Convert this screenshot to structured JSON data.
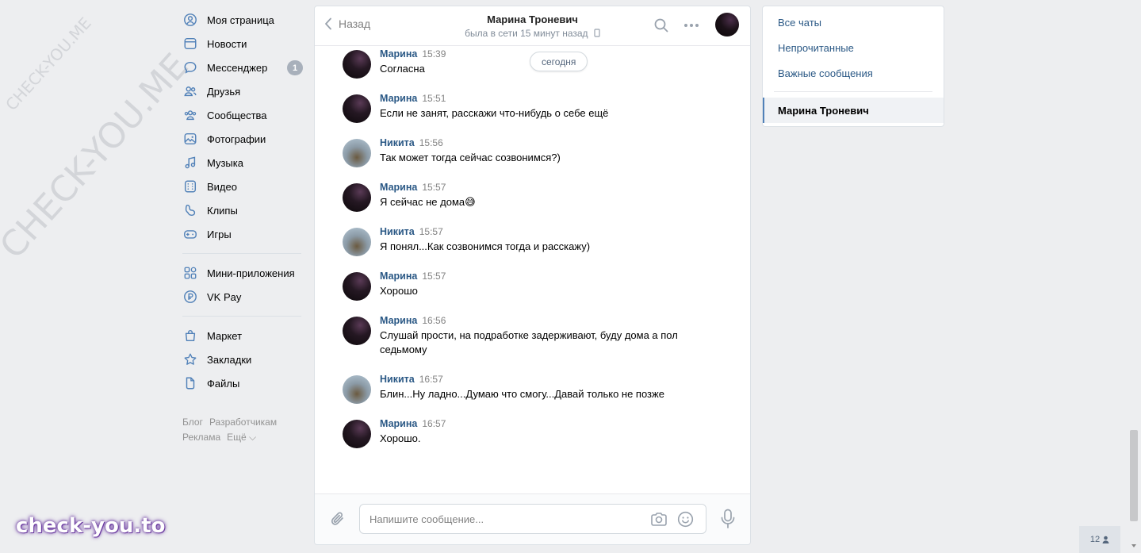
{
  "watermark": {
    "small": "CHECK-YOU.ME",
    "big": "CHECK-YOU.ME"
  },
  "brand": "check-you.to",
  "nav": {
    "items": [
      {
        "label": "Моя страница",
        "icon": "user-circle-icon"
      },
      {
        "label": "Новости",
        "icon": "newspaper-icon"
      },
      {
        "label": "Мессенджер",
        "icon": "chat-bubble-icon",
        "badge": "1"
      },
      {
        "label": "Друзья",
        "icon": "friends-icon"
      },
      {
        "label": "Сообщества",
        "icon": "communities-icon"
      },
      {
        "label": "Фотографии",
        "icon": "photo-icon"
      },
      {
        "label": "Музыка",
        "icon": "music-note-icon"
      },
      {
        "label": "Видео",
        "icon": "video-icon"
      },
      {
        "label": "Клипы",
        "icon": "clips-icon"
      },
      {
        "label": "Игры",
        "icon": "gamepad-icon"
      }
    ],
    "apps": [
      {
        "label": "Мини-приложения",
        "icon": "mini-apps-icon"
      },
      {
        "label": "VK Pay",
        "icon": "vk-pay-icon"
      }
    ],
    "extras": [
      {
        "label": "Маркет",
        "icon": "shopping-bag-icon"
      },
      {
        "label": "Закладки",
        "icon": "star-icon"
      },
      {
        "label": "Файлы",
        "icon": "file-icon"
      }
    ],
    "footer": {
      "blog": "Блог",
      "developers": "Разработчикам",
      "ads": "Реклама",
      "more": "Ещё ⌵"
    }
  },
  "chat": {
    "back_label": "Назад",
    "peer_name": "Марина Троневич",
    "peer_status": "была в сети 15 минут назад",
    "today_label": "сегодня",
    "messages": [
      {
        "author": "Марина",
        "time": "15:39",
        "text": "Согласна"
      },
      {
        "author": "Марина",
        "time": "15:51",
        "text": "Если не занят, расскажи что-нибудь о себе ещё"
      },
      {
        "author": "Никита",
        "time": "15:56",
        "text": "Так может тогда сейчас созвонимся?)"
      },
      {
        "author": "Марина",
        "time": "15:57",
        "text": "Я сейчас не дома😅"
      },
      {
        "author": "Никита",
        "time": "15:57",
        "text": "Я понял...Как созвонимся тогда и расскажу)"
      },
      {
        "author": "Марина",
        "time": "15:57",
        "text": "Хорошо"
      },
      {
        "author": "Марина",
        "time": "16:56",
        "text": "Слушай прости, на подработке задерживают, буду дома а пол седьмому"
      },
      {
        "author": "Никита",
        "time": "16:57",
        "text": "Блин...Ну ладно...Думаю что смогу...Давай только не позже"
      },
      {
        "author": "Марина",
        "time": "16:57",
        "text": "Хорошо."
      }
    ],
    "composer_placeholder": "Напишите сообщение..."
  },
  "right_panel": {
    "all_chats": "Все чаты",
    "unread": "Непрочитанные",
    "important": "Важные сообщения",
    "active_chat": "Марина Троневич"
  },
  "counter": "12",
  "colors": {
    "link": "#2a5885",
    "accent": "#5181b8",
    "bg": "#edeef0"
  }
}
